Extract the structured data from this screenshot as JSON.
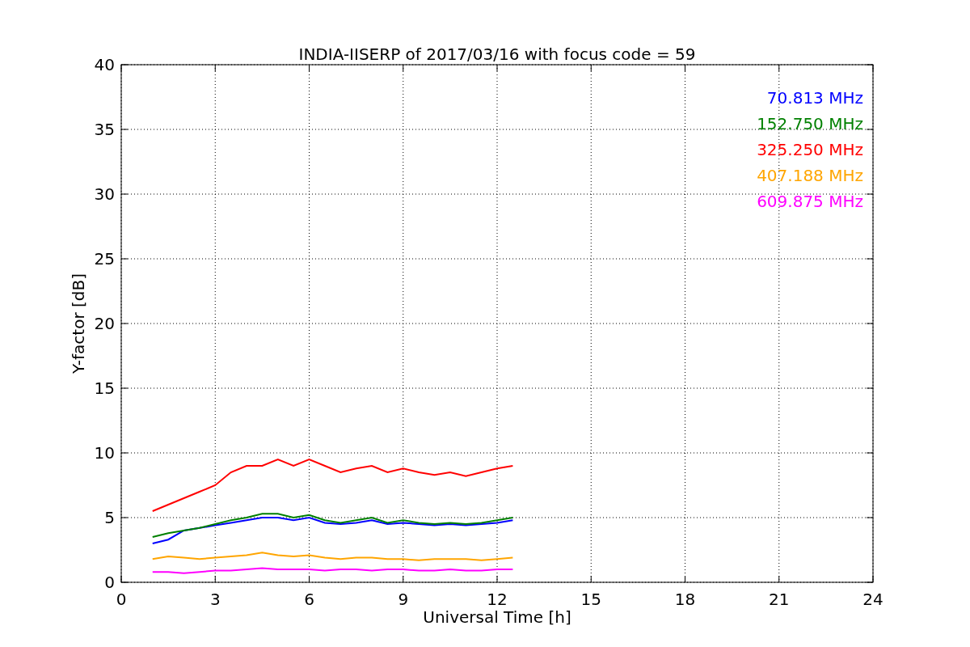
{
  "figure": {
    "chart_data": {
      "type": "line",
      "title": "INDIA-IISERP of 2017/03/16 with focus code = 59",
      "xlabel": "Universal Time [h]",
      "ylabel": "Y-factor [dB]",
      "xlim": [
        0,
        24
      ],
      "ylim": [
        0,
        40
      ],
      "grid": true,
      "xticks": [
        0,
        3,
        6,
        9,
        12,
        15,
        18,
        21,
        24
      ],
      "yticks": [
        0,
        5,
        10,
        15,
        20,
        25,
        30,
        35,
        40
      ],
      "x": [
        1,
        1.5,
        2,
        2.5,
        3,
        3.5,
        4,
        4.5,
        5,
        5.5,
        6,
        6.5,
        7,
        7.5,
        8,
        8.5,
        9,
        9.5,
        10,
        10.5,
        11,
        11.5,
        12,
        12.5
      ],
      "series": [
        {
          "name": "70.813 MHz",
          "color": "#0000ff",
          "values": [
            3.0,
            3.3,
            4,
            4.2,
            4.4,
            4.6,
            4.8,
            5,
            5,
            4.8,
            5,
            4.6,
            4.5,
            4.6,
            4.8,
            4.5,
            4.6,
            4.5,
            4.4,
            4.5,
            4.4,
            4.5,
            4.6,
            4.8
          ]
        },
        {
          "name": "152.750 MHz",
          "color": "#008000",
          "values": [
            3.5,
            3.8,
            4,
            4.2,
            4.5,
            4.8,
            5,
            5.3,
            5.3,
            5,
            5.2,
            4.8,
            4.6,
            4.8,
            5,
            4.6,
            4.8,
            4.6,
            4.5,
            4.6,
            4.5,
            4.6,
            4.8,
            5
          ]
        },
        {
          "name": "325.250 MHz",
          "color": "#ff0000",
          "values": [
            5.5,
            6,
            6.5,
            7,
            7.5,
            8.5,
            9,
            9,
            9.5,
            9,
            9.5,
            9,
            8.5,
            8.8,
            9,
            8.5,
            8.8,
            8.5,
            8.3,
            8.5,
            8.2,
            8.5,
            8.8,
            9
          ]
        },
        {
          "name": "407.188 MHz",
          "color": "#ffa500",
          "values": [
            1.8,
            2,
            1.9,
            1.8,
            1.9,
            2,
            2.1,
            2.3,
            2.1,
            2,
            2.1,
            1.9,
            1.8,
            1.9,
            1.9,
            1.8,
            1.8,
            1.7,
            1.8,
            1.8,
            1.8,
            1.7,
            1.8,
            1.9
          ]
        },
        {
          "name": "609.875 MHz",
          "color": "#ff00ff",
          "values": [
            0.8,
            0.8,
            0.7,
            0.8,
            0.9,
            0.9,
            1,
            1.1,
            1,
            1,
            1,
            0.9,
            1,
            1,
            0.9,
            1,
            1,
            0.9,
            0.9,
            1,
            0.9,
            0.9,
            1,
            1
          ]
        }
      ]
    }
  }
}
